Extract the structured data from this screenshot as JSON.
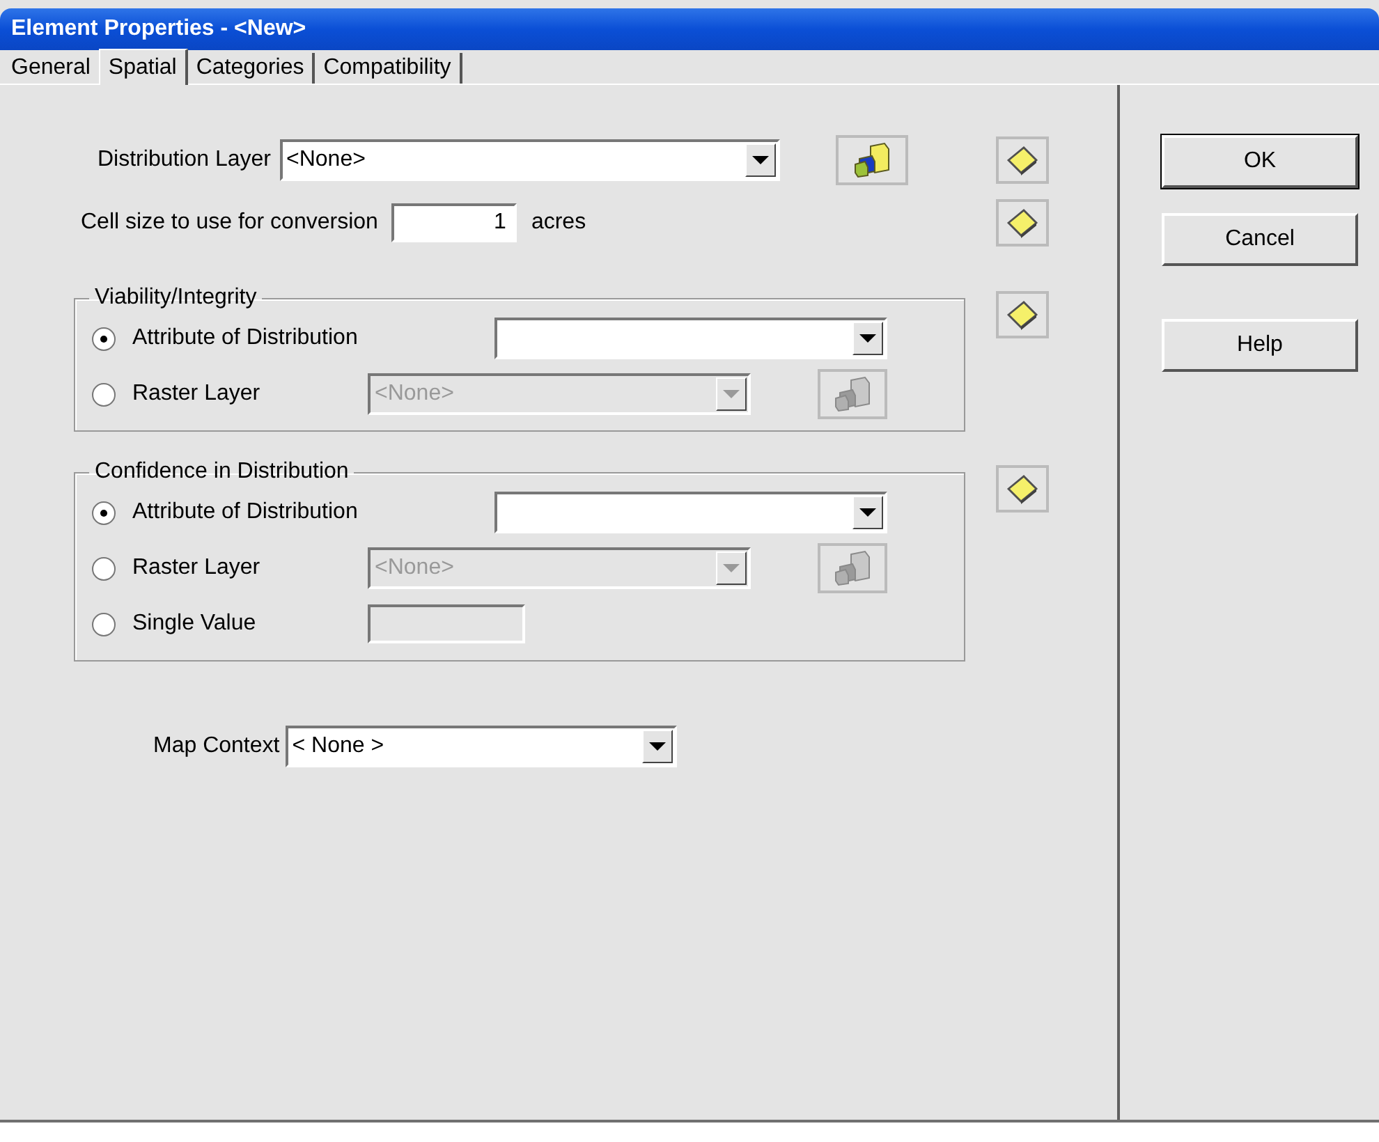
{
  "window": {
    "title": "Element Properties - <New>"
  },
  "tabs": [
    {
      "label": "General",
      "selected": false
    },
    {
      "label": "Spatial",
      "selected": true
    },
    {
      "label": "Categories",
      "selected": false
    },
    {
      "label": "Compatibility",
      "selected": false
    }
  ],
  "distribution_layer": {
    "label": "Distribution Layer",
    "value": "<None>"
  },
  "cell_size": {
    "label": "Cell size to use for conversion",
    "value": "1",
    "unit": "acres"
  },
  "groups": [
    {
      "title": "Viability/Integrity",
      "options": [
        {
          "label": "Attribute of Distribution",
          "selected": true,
          "kind": "combo",
          "disabled": false
        },
        {
          "label": "Raster Layer",
          "selected": false,
          "kind": "layer",
          "value": "<None>",
          "disabled": true
        }
      ]
    },
    {
      "title": "Confidence in Distribution",
      "options": [
        {
          "label": "Attribute of Distribution",
          "selected": true,
          "kind": "combo",
          "disabled": false
        },
        {
          "label": "Raster Layer",
          "selected": false,
          "kind": "layer",
          "value": "<None>",
          "disabled": true
        },
        {
          "label": "Single Value",
          "selected": false,
          "kind": "text",
          "disabled": true
        }
      ]
    }
  ],
  "map_context": {
    "label": "Map Context",
    "value": "< None >"
  },
  "buttons": [
    {
      "label": "OK",
      "default": true
    },
    {
      "label": "Cancel",
      "default": false
    },
    {
      "label": "Help",
      "default": false
    }
  ]
}
